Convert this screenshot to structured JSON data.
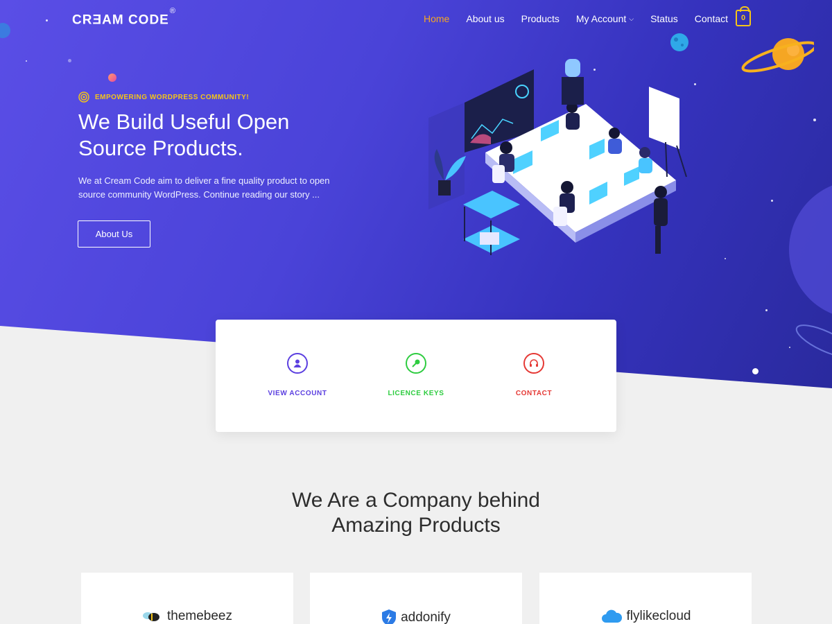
{
  "brand": {
    "name": "CRƎAM CODE",
    "registered": "®"
  },
  "nav": {
    "items": [
      {
        "label": "Home",
        "active": true
      },
      {
        "label": "About us"
      },
      {
        "label": "Products"
      },
      {
        "label": "My Account",
        "has_dropdown": true
      },
      {
        "label": "Status"
      },
      {
        "label": "Contact"
      }
    ],
    "cart_count": "0"
  },
  "hero": {
    "tagline": "EMPOWERING WORDPRESS COMMUNITY!",
    "title_line1": "We Build Useful Open",
    "title_line2": "Source Products.",
    "text": "We at Cream Code aim to deliver a fine quality product to open source community WordPress. Continue reading our story ...",
    "button": "About Us"
  },
  "quick_links": [
    {
      "label": "VIEW ACCOUNT",
      "icon": "user-icon",
      "color": "#5b3fe0"
    },
    {
      "label": "LICENCE KEYS",
      "icon": "key-icon",
      "color": "#2ecc40"
    },
    {
      "label": "CONTACT",
      "icon": "headset-icon",
      "color": "#e53935"
    }
  ],
  "section": {
    "title_line1": "We Are a Company behind",
    "title_line2": "Amazing Products"
  },
  "brands": [
    {
      "name": "themebeez",
      "icon": "bee-icon"
    },
    {
      "name": "addonify",
      "icon": "lightning-shield-icon"
    },
    {
      "name": "flylikecloud",
      "icon": "cloud-icon"
    }
  ],
  "colors": {
    "hero_start": "#5a4ee6",
    "hero_end": "#2a2a9e",
    "accent_orange": "#f5a623",
    "accent_yellow": "#f5c518"
  }
}
